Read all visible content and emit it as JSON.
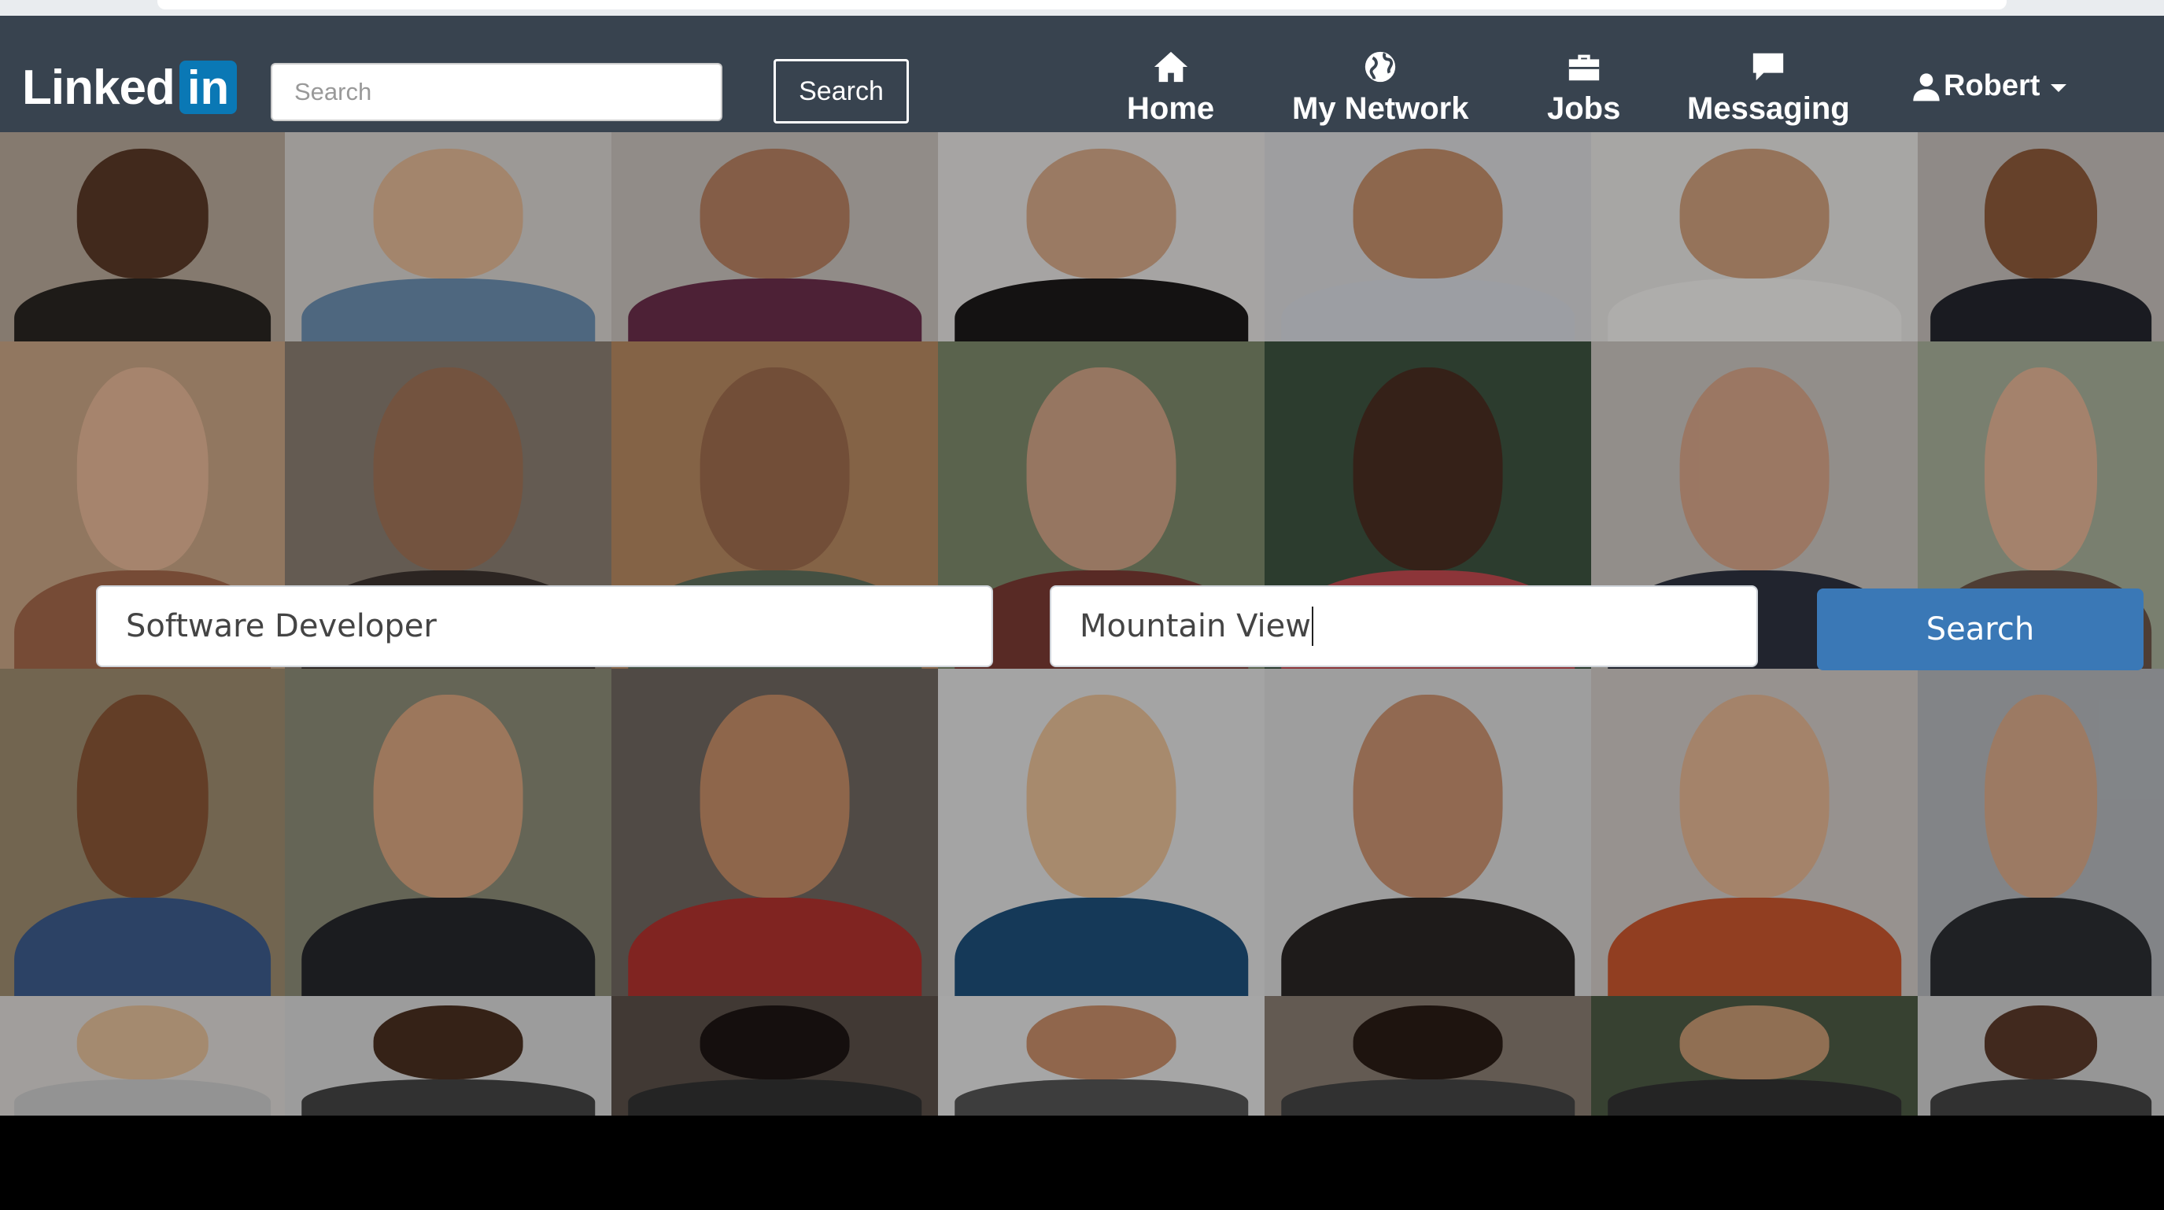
{
  "navbar": {
    "logo_text": "Linked",
    "logo_box": "in",
    "search_placeholder": "Search",
    "search_button": "Search",
    "items": [
      {
        "label": "Home",
        "icon": "home-icon"
      },
      {
        "label": "My Network",
        "icon": "globe-icon"
      },
      {
        "label": "Jobs",
        "icon": "briefcase-icon"
      },
      {
        "label": "Messaging",
        "icon": "chat-icon"
      }
    ],
    "user": {
      "name": "Robert",
      "icon": "user-icon"
    }
  },
  "hero": {
    "what_value": "Software Developer",
    "where_value": "Mountain View",
    "search_button": "Search"
  },
  "colors": {
    "navbar": "#38434f",
    "logo_blue": "#0a78b5",
    "search_button": "#3a78b6"
  }
}
